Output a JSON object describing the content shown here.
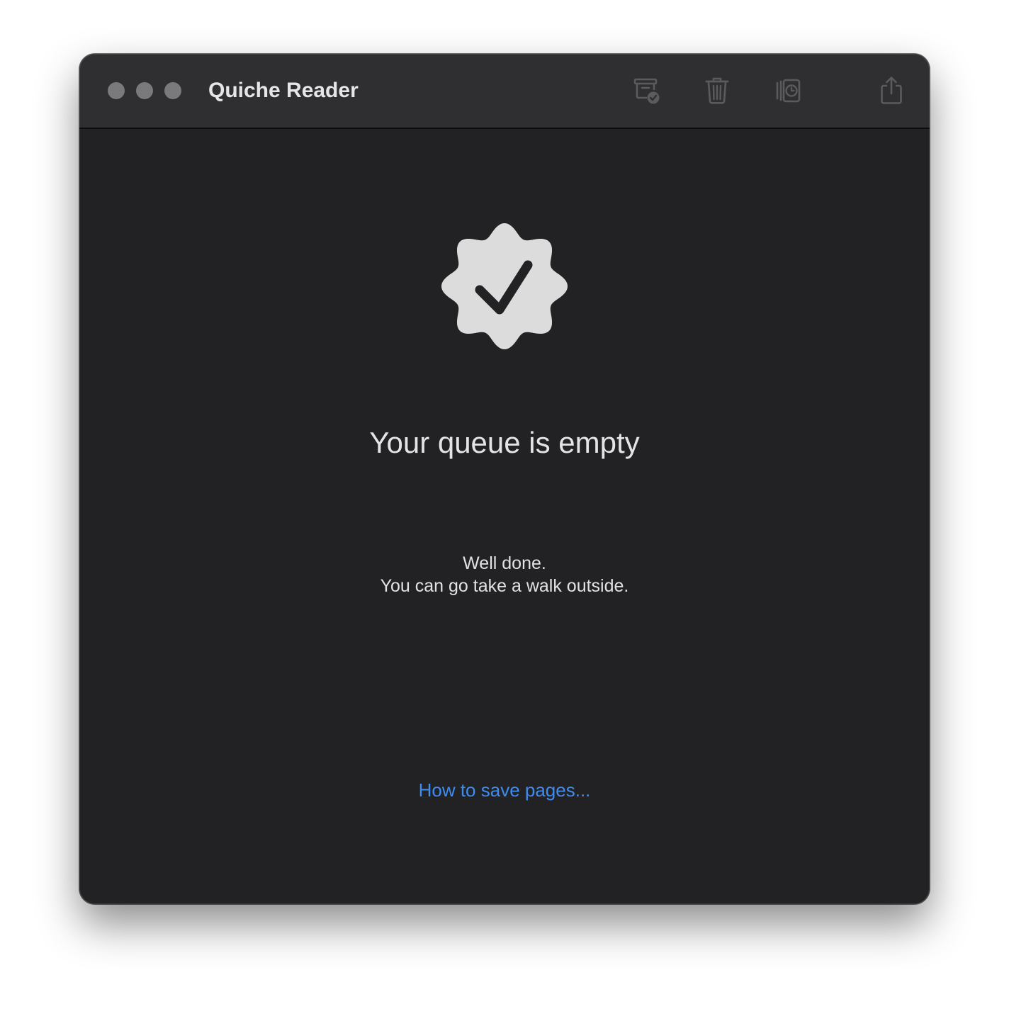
{
  "window": {
    "title": "Quiche Reader"
  },
  "toolbar": {
    "icons": [
      "archive-icon",
      "trash-icon",
      "read-later-icon",
      "share-icon"
    ]
  },
  "empty_state": {
    "icon": "check-badge-icon",
    "headline": "Your queue is empty",
    "message_line1": "Well done.",
    "message_line2": "You can go take a walk outside.",
    "help_link": "How to save pages..."
  },
  "colors": {
    "window_background": "#222123",
    "titlebar_background": "#2f2e30",
    "link": "#3f8cf0",
    "text": "#e4e4e5",
    "icon_disabled": "#5b5a5d",
    "badge_fill": "#dcdcdd"
  }
}
